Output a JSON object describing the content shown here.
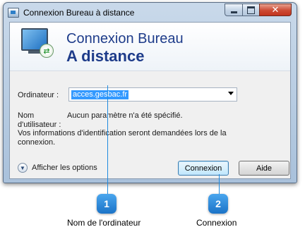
{
  "window": {
    "title": "Connexion Bureau à distance",
    "minimize_icon": "minimize-icon",
    "maximize_icon": "maximize-icon",
    "close_glyph": "✕"
  },
  "banner": {
    "title_line1": "Connexion Bureau",
    "title_line2": "A distance",
    "icon": "remote-desktop-monitor-icon",
    "badge_glyph": "⇄"
  },
  "form": {
    "computer_label": "Ordinateur :",
    "computer_value": "acces.gesbac.fr",
    "username_label_line1": "Nom",
    "username_label_line2": "d'utilisateur :",
    "username_value": "Aucun paramètre n'a été spécifié.",
    "info_text": "Vos informations d'identification seront demandées lors de la connexion."
  },
  "footer": {
    "options_glyph": "▼",
    "options_label": "Afficher les options",
    "connect_label": "Connexion",
    "help_label": "Aide"
  },
  "callouts": [
    {
      "number": "1",
      "caption": "Nom de l'ordinateur"
    },
    {
      "number": "2",
      "caption": "Connexion"
    }
  ],
  "colors": {
    "accent": "#1e3c8a",
    "marker": "#1f8be0",
    "selection": "#3399ff"
  }
}
